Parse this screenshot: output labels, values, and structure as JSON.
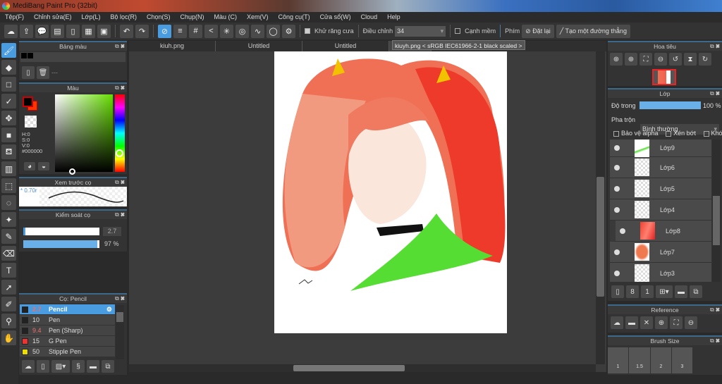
{
  "app": {
    "title": "MediBang Paint Pro (32bit)"
  },
  "menu": [
    "Tệp(F)",
    "Chỉnh sửa(E)",
    "Lớp(L)",
    "Bộ lọc(R)",
    "Chọn(S)",
    "Chụp(N)",
    "Màu (C)",
    "Xem(V)",
    "Công cụ(T)",
    "Cửa sổ(W)",
    "Cloud",
    "Help"
  ],
  "toolbar": {
    "antialias_label": "Khử răng cưa",
    "adjust_label": "Điều chỉnh",
    "adjust_value": "34",
    "soft_edge_label": "Cạnh mềm",
    "key_label": "Phím",
    "reset_label": "Đặt lại",
    "straight_line_label": "Tạo một đường thẳng"
  },
  "tabs": [
    "kiuh.png",
    "Untitled",
    "Untitled",
    "kiuyh"
  ],
  "tooltip": "kiuyh.png < sRGB IEC61966-2-1 black scaled >",
  "palette": {
    "title": "Bảng màu",
    "dash": "---"
  },
  "color": {
    "title": "Màu",
    "h": "H:0",
    "s": "S:0",
    "v": "V:0",
    "hex": "#000000",
    "primary": "#000000",
    "secondary": "#ff3300"
  },
  "brush_preview": {
    "title": "Xem trước cọ",
    "size": "* 0.70r"
  },
  "brush_control": {
    "title": "Kiểm soát cọ",
    "size": "2.7",
    "opacity": "97 %",
    "opacity_value": 97
  },
  "brushes": {
    "title": "Cọ: Pencil",
    "items": [
      {
        "size": "2.7",
        "name": "Pencil",
        "color": "#222222",
        "selected": true
      },
      {
        "size": "10",
        "name": "Pen",
        "color": "#222222"
      },
      {
        "size": "9.4",
        "name": "Pen (Sharp)",
        "color": "#222222"
      },
      {
        "size": "15",
        "name": "G Pen",
        "color": "#ee3333"
      },
      {
        "size": "50",
        "name": "Stipple Pen",
        "color": "#eedd00"
      }
    ]
  },
  "navigator": {
    "title": "Hoa tiêu"
  },
  "layers": {
    "title": "Lớp",
    "opacity_label": "Độ trong",
    "opacity": "100 %",
    "opacity_value": 100,
    "blend_label": "Pha trộn",
    "blend": "Bình thường",
    "protect_alpha": "Bảo vệ alpha",
    "clipping": "Xén bớt",
    "lock": "Khóa",
    "items": [
      {
        "name": "Lớp9"
      },
      {
        "name": "Lớp6"
      },
      {
        "name": "Lớp5"
      },
      {
        "name": "Lớp4"
      },
      {
        "name": "Lớp8"
      },
      {
        "name": "Lớp7"
      },
      {
        "name": "Lớp3"
      }
    ]
  },
  "reference": {
    "title": "Reference"
  },
  "brush_size": {
    "title": "Brush Size",
    "sizes": [
      "1",
      "1.5",
      "2",
      "3"
    ]
  }
}
